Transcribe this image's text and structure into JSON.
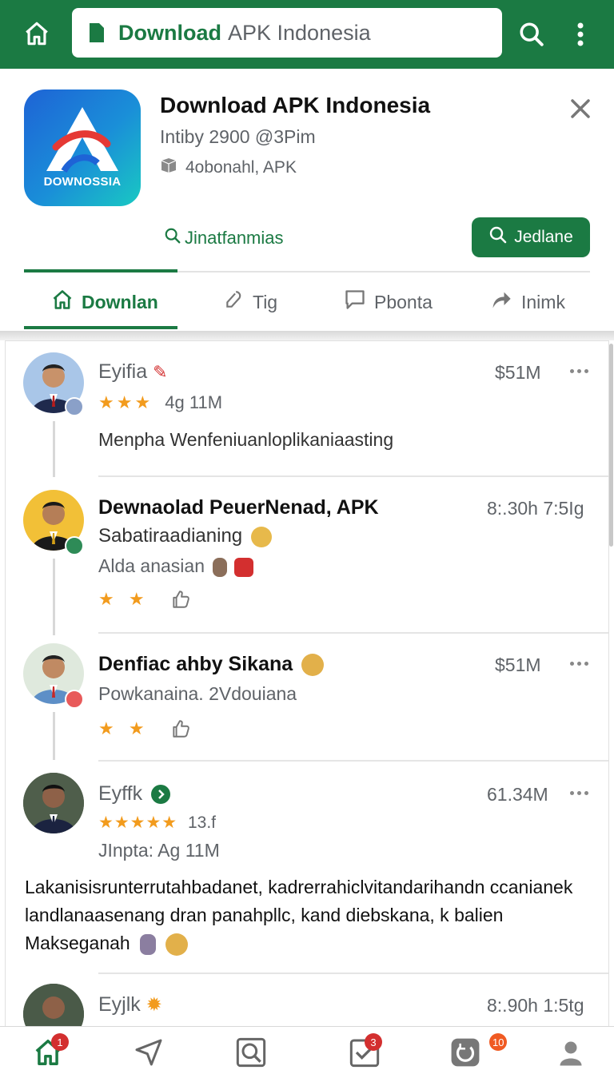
{
  "topbar": {
    "url_brand": "Download",
    "url_rest": "APK Indonesia"
  },
  "app": {
    "icon_text": "DOWNOSSIA",
    "title": "Download APK Indonesia",
    "line1": "Intiby 2900 @3Pim",
    "line2": "4obonahl, APK",
    "link_label": "Jinatfanmias",
    "button_label": "Jedlane"
  },
  "tabs": [
    {
      "label": "Downlan",
      "icon": "home-icon"
    },
    {
      "label": "Tig",
      "icon": "tag-icon"
    },
    {
      "label": "Pbonta",
      "icon": "comment-icon"
    },
    {
      "label": "Inimk",
      "icon": "share-icon"
    }
  ],
  "posts": [
    {
      "name": "Eyifia",
      "meta": "$51M",
      "stars": "★★★",
      "stars_text": "4g 11M",
      "text": "Menpha Wenfeniuanloplikaniaasting"
    },
    {
      "name": "Dewnaolad PeuerNenad, APK",
      "meta": "8:.30h 7:5Ig",
      "line1": "Sabatiraadianing",
      "line2": "Alda anasian",
      "stars": "★ ★"
    },
    {
      "name": "Denfiac ahby Sikana",
      "meta": "$51M",
      "line1": "Powkanaina. 2Vdouiana",
      "stars": "★ ★"
    },
    {
      "name": "Eyffk",
      "meta": "61.34M",
      "stars": "★★★★★",
      "stars_text": "13.f",
      "line1": "JInpta: Ag 11M",
      "body": "Lakanisisrunterrutahbadanet, kadrerrahiclvitandarihandn ccanianek landlanaasenang dran panahpllc, kand diebskana, k balien Makseganah"
    },
    {
      "name": "Eyjlk",
      "meta": "8:.90h 1:5tg"
    }
  ],
  "bottomnav": {
    "home_badge": "1",
    "tasks_badge": "3",
    "refresh_badge": "10"
  },
  "colors": {
    "brand_green": "#1b7a43",
    "star_orange": "#f29b1d",
    "badge_red": "#d32f2f"
  }
}
